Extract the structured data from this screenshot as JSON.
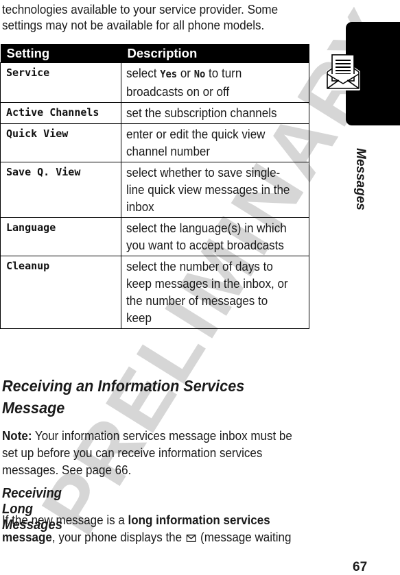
{
  "watermark": "PRELIMINARY",
  "intro": "technologies available to your service provider. Some settings may not be available for all phone models.",
  "table": {
    "headers": [
      "Setting",
      "Description"
    ],
    "rows": [
      {
        "setting": "Service",
        "description_parts": [
          "select ",
          "Yes",
          " or ",
          "No",
          " to turn broadcasts on or off"
        ]
      },
      {
        "setting": "Active Channels",
        "description": "set the subscription channels"
      },
      {
        "setting": "Quick View",
        "description": "enter or edit the quick view channel number"
      },
      {
        "setting": "Save Q. View",
        "description": "select whether to save single-line quick view messages in the inbox"
      },
      {
        "setting": "Language",
        "description": "select the language(s) in which you want to accept broadcasts"
      },
      {
        "setting": "Cleanup",
        "description": "select the number of days to keep messages in the inbox, or the number of messages to keep"
      }
    ]
  },
  "section_heading": "Receiving an Information Services Message",
  "note": {
    "label": "Note:",
    "text": " Your information services message inbox must be set up before you can receive information services messages. See page 66."
  },
  "subheading": "Receiving Long Messages",
  "long_para": {
    "prefix": "If the new message is a ",
    "bold": "long information services message",
    "middle": ", your phone displays the ",
    "icon": "envelope-icon",
    "suffix": " (message waiting"
  },
  "side_tab": {
    "label": "Messages",
    "icon": "open-envelope-letter-icon"
  },
  "page_number": "67"
}
